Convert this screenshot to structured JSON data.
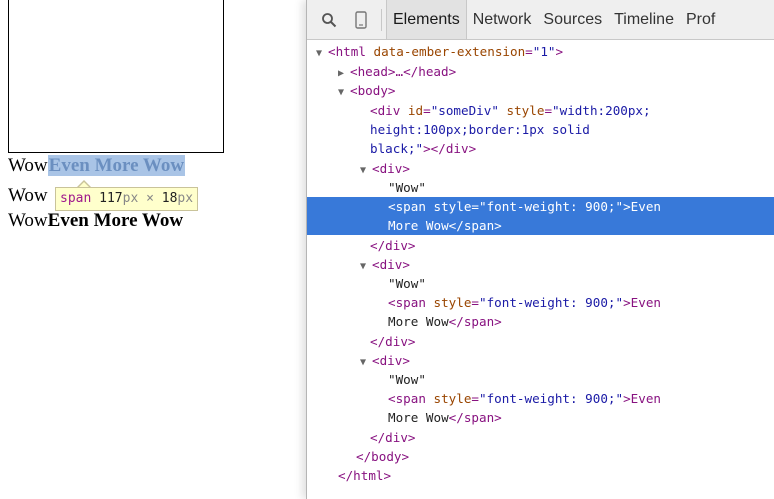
{
  "page": {
    "word": "Wow",
    "bold_text": "Even More Wow"
  },
  "tooltip": {
    "tag": "span",
    "width": "117",
    "height": "18",
    "unit": "px",
    "times": "×"
  },
  "devtools": {
    "tabs": [
      {
        "label": "Elements",
        "active": true
      },
      {
        "label": "Network",
        "active": false
      },
      {
        "label": "Sources",
        "active": false
      },
      {
        "label": "Timeline",
        "active": false
      },
      {
        "label": "Prof",
        "active": false
      }
    ],
    "icons": {
      "search": "search-icon",
      "device": "device-mode-icon"
    },
    "colors": {
      "selection": "#3879d9",
      "tag": "#881280",
      "attr_name": "#994500",
      "attr_value": "#1a1aa6"
    },
    "tree": {
      "html_open": {
        "tag": "<html",
        "attr": " data-ember-extension",
        "eq": "=",
        "val": "\"1\"",
        "end": ">"
      },
      "head": {
        "text": "<head>…</head>"
      },
      "body_open": {
        "text": "<body>"
      },
      "somediv_1": {
        "tag": "<div",
        "attr1": " id",
        "eq1": "=",
        "val1": "\"someDiv\"",
        "attr2": " style",
        "eq2": "=",
        "val2": "\"width:200px;"
      },
      "somediv_2": {
        "val": "height:100px;border:1px solid"
      },
      "somediv_3": {
        "val": "black;\"",
        "end": "></div>"
      },
      "div_open": "<div>",
      "wow_text": "\"Wow\"",
      "span_line1": {
        "tag": "<span",
        "attr": " style",
        "eq": "=",
        "val": "\"font-weight: 900;\"",
        "end": ">Even"
      },
      "span_line2": {
        "text": "More Wow",
        "end": "</span>"
      },
      "div_close": "</div>",
      "body_close": "</body>",
      "html_close": "</html>"
    }
  }
}
